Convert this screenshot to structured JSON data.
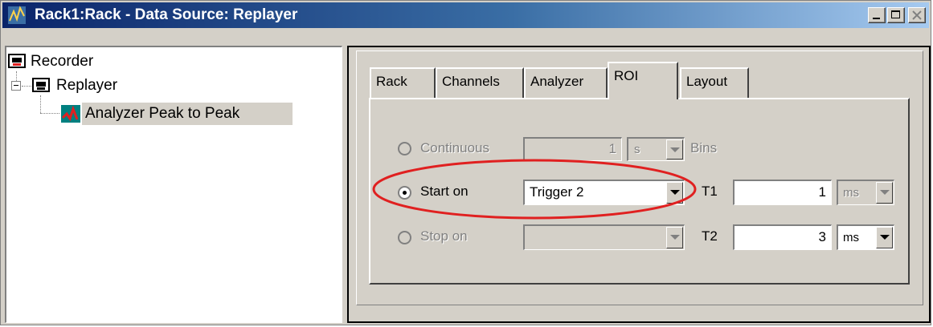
{
  "window": {
    "title": "Rack1:Rack - Data Source: Replayer"
  },
  "tree": {
    "items": [
      {
        "label": "Recorder"
      },
      {
        "label": "Replayer"
      },
      {
        "label": "Analyzer Peak to Peak"
      }
    ]
  },
  "tabs": [
    {
      "label": "Rack"
    },
    {
      "label": "Channels"
    },
    {
      "label": "Analyzer"
    },
    {
      "label": "ROI"
    },
    {
      "label": "Layout"
    }
  ],
  "roi": {
    "continuous": {
      "label": "Continuous",
      "value": "1",
      "unit": "s",
      "suffix": "Bins"
    },
    "start_on": {
      "label": "Start on",
      "selected": "Trigger 2"
    },
    "stop_on": {
      "label": "Stop on",
      "selected": ""
    },
    "t1": {
      "label": "T1",
      "value": "1",
      "unit": "ms"
    },
    "t2": {
      "label": "T2",
      "value": "3",
      "unit": "ms"
    }
  },
  "annotation": {
    "color": "#e02020"
  }
}
